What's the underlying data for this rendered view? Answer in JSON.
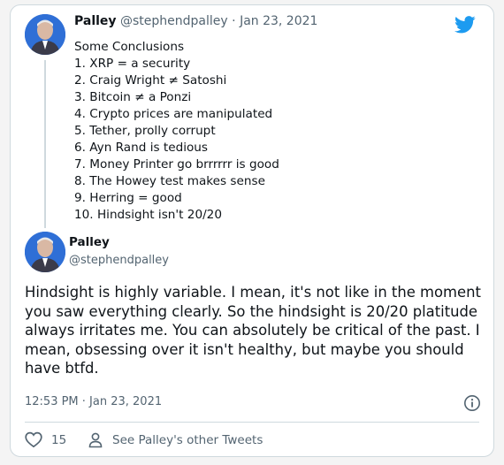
{
  "quoted_tweet": {
    "name": "Palley",
    "handle": "@stephendpalley",
    "separator": "·",
    "date": "Jan 23, 2021",
    "lines": [
      "Some Conclusions",
      "1. XRP = a security",
      "2. Craig Wright ≠ Satoshi",
      "3. Bitcoin ≠ a Ponzi",
      "4. Crypto prices are manipulated",
      "5. Tether, prolly corrupt",
      "6. Ayn Rand is tedious",
      "7.  Money Printer go brrrrrr is good",
      "8. The Howey test makes sense",
      "9. Herring = good",
      "10. Hindsight isn't 20/20"
    ]
  },
  "tweet": {
    "name": "Palley",
    "handle": "@stephendpalley",
    "text": "Hindsight is highly variable.  I mean, it's not like in the moment you saw everything clearly.  So the hindsight is 20/20 platitude always irritates me.  You can absolutely be critical of the past.  I mean, obsessing over it isn't healthy, but maybe you should have btfd.",
    "timestamp": "12:53 PM · Jan 23, 2021"
  },
  "actions": {
    "like_count": "15",
    "see_tweets_label": "See Palley's other Tweets"
  },
  "icons": {
    "brand": "twitter-bird-icon",
    "info": "info-icon",
    "like": "heart-icon",
    "profile": "person-icon"
  },
  "colors": {
    "twitter_blue": "#1d9bf0",
    "text_primary": "#0f1419",
    "text_secondary": "#536471",
    "border": "#cfd9de"
  }
}
